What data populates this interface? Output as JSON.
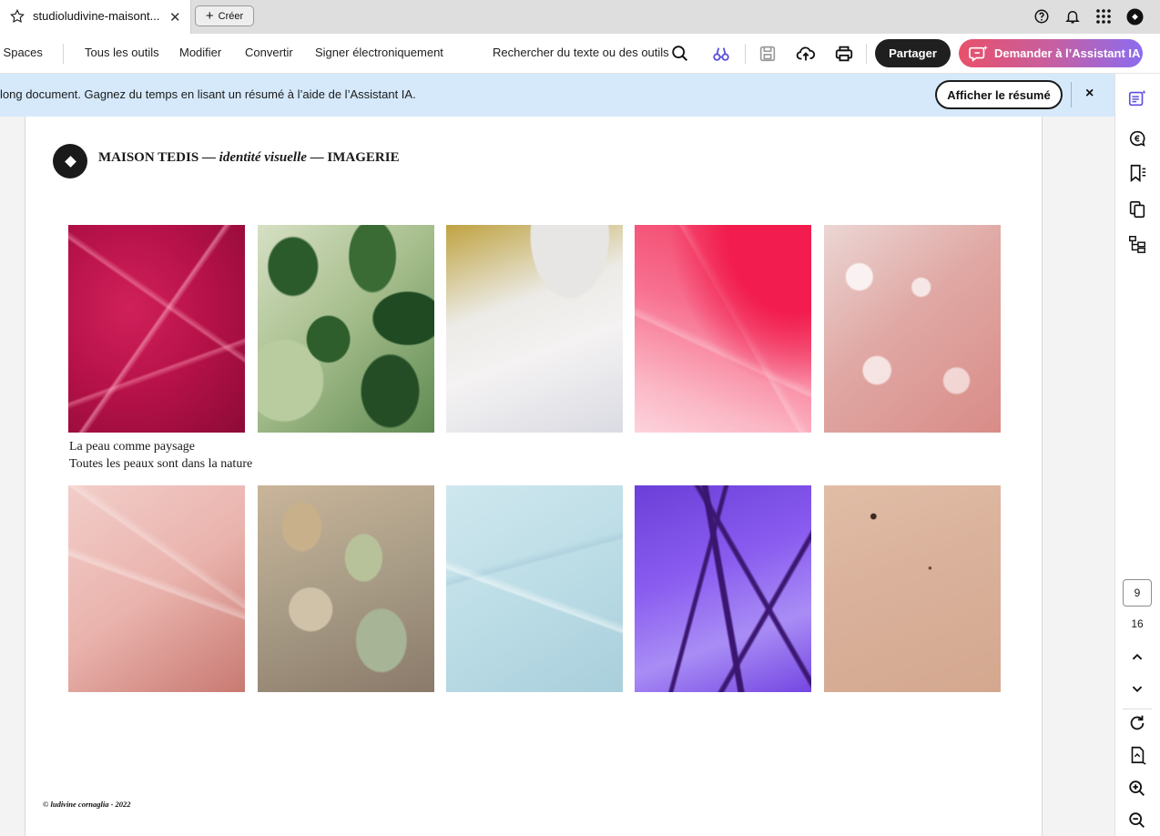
{
  "browser": {
    "tab_title": "studioludivine-maisont...",
    "create_label": "Créer"
  },
  "toolbar": {
    "spaces": "F Spaces",
    "all_tools": "Tous les outils",
    "edit": "Modifier",
    "convert": "Convertir",
    "sign": "Signer électroniquement",
    "search": "Rechercher du texte ou des outils",
    "share": "Partager",
    "ai_assistant": "Demander à l’Assistant IA"
  },
  "banner": {
    "text": "long document. Gagnez du temps en lisant un résumé à l’aide de l’Assistant IA.",
    "summary_button": "Afficher le résumé",
    "close": "×"
  },
  "document": {
    "header_part1": "MAISON TEDIS — ",
    "header_italic": "identité visuelle",
    "header_part2": " — IMAGERIE",
    "caption_line1": "La peau comme paysage",
    "caption_line2": "Toutes les peaux sont dans la nature",
    "footer": "© ludivine cornaglia - 2022",
    "images": [
      "red-leaf-veins",
      "variegated-green-leaf",
      "white-petal",
      "pink-red-petal",
      "pink-quartz",
      "pink-skin-texture",
      "bark-texture",
      "pale-blue-marble",
      "purple-petal-veins",
      "sand-texture"
    ]
  },
  "pager": {
    "current": "9",
    "total": "16"
  }
}
